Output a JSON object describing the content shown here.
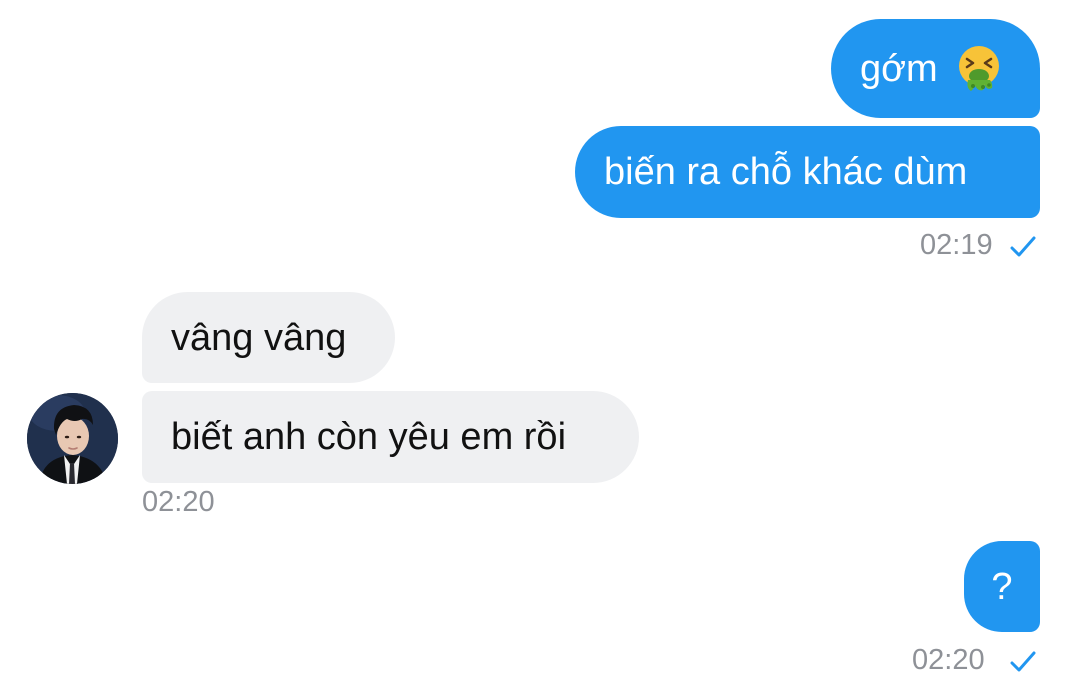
{
  "messages": [
    {
      "id": "m1",
      "direction": "sent",
      "text": "gớm",
      "emoji": "vomiting-face"
    },
    {
      "id": "m2",
      "direction": "sent",
      "text": "biến ra chỗ khác dùm"
    },
    {
      "id": "m3",
      "direction": "received",
      "text": "vâng vâng"
    },
    {
      "id": "m4",
      "direction": "received",
      "text": "biết anh còn yêu em rồi"
    },
    {
      "id": "m5",
      "direction": "sent",
      "text": "?"
    }
  ],
  "timestamps": {
    "group1": "02:19",
    "group2": "02:20",
    "group3": "02:20"
  },
  "colors": {
    "sent_bubble": "#2196f0",
    "received_bubble": "#eff0f2",
    "timestamp": "#8e9197",
    "read_check": "#2196f0"
  },
  "icons": {
    "read_receipt": "check-icon",
    "contact_avatar": "avatar"
  }
}
